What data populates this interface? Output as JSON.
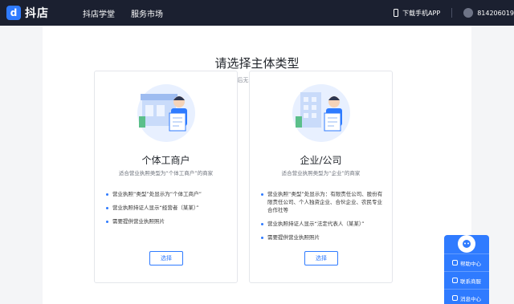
{
  "header": {
    "logo_mark": "d",
    "logo_text": "抖店",
    "nav": [
      "抖店学堂",
      "服务市场"
    ],
    "download_label": "下载手机APP",
    "user_id": "814206019"
  },
  "main": {
    "title": "请选择主体类型",
    "subtitle": "主体类型一旦选择，认证后无法修改，请选择符合要求的主体类型"
  },
  "cards": [
    {
      "title": "个体工商户",
      "subtitle": "适合营业执照类型为“个体工商户”的商家",
      "bullets": [
        "营业执照“类型”处显示为“个体工商户”",
        "营业执照持证人显示“经营者（某某）”",
        "需要提供营业执照照片"
      ],
      "button": "选择"
    },
    {
      "title": "企业/公司",
      "subtitle": "适合营业执照类型为“企业”的商家",
      "bullets": [
        "营业执照“类型”处显示为：有限责任公司、股份有限责任公司、个人独资企业、合伙企业、农民专业合作社等",
        "营业执照持证人显示“法定代表人（某某）”",
        "需要提供营业执照照片"
      ],
      "button": "选择"
    }
  ],
  "float_panel": {
    "items": [
      "帮助中心",
      "联系商服",
      "消息中心"
    ]
  },
  "colors": {
    "accent": "#2f7bff",
    "topbar": "#1b2030"
  }
}
